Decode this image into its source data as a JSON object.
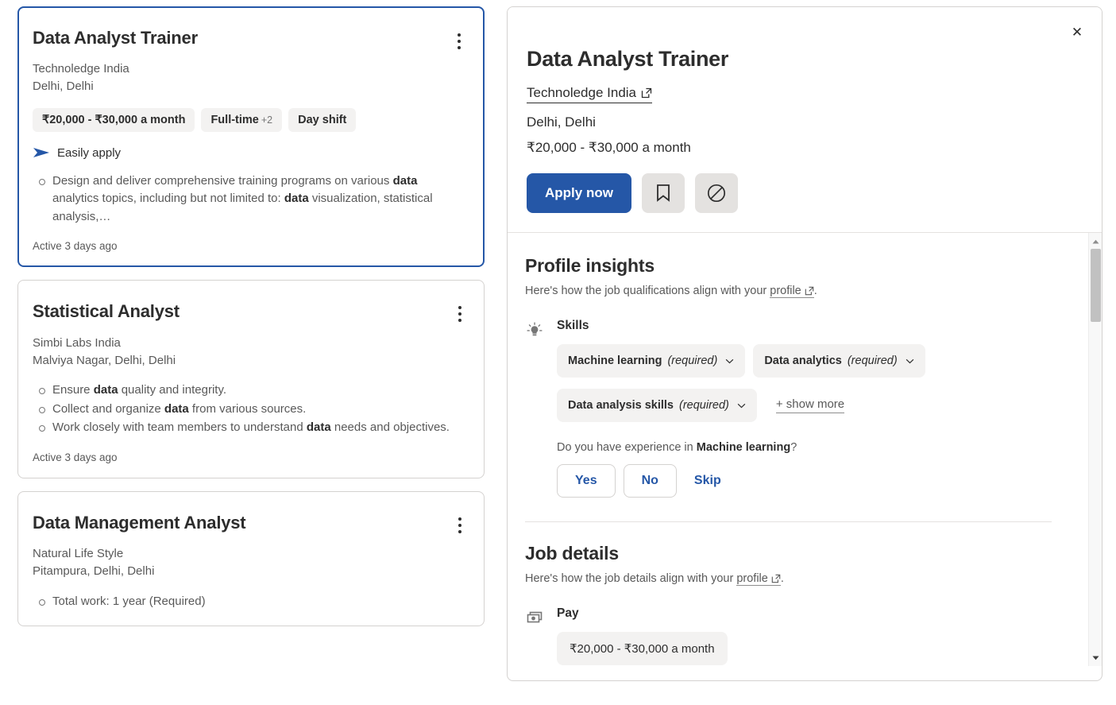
{
  "results": {
    "cards": [
      {
        "title": "Data Analyst Trainer",
        "company": "Technoledge India",
        "location": "Delhi, Delhi",
        "chips": [
          {
            "text": "₹20,000 - ₹30,000 a month",
            "extra": ""
          },
          {
            "text": "Full-time",
            "extra": "+2"
          },
          {
            "text": "Day shift",
            "extra": ""
          }
        ],
        "easily_apply": "Easily apply",
        "bullets": [
          "Design and deliver comprehensive training programs on various <b>data</b> analytics topics, including but not limited to: <b>data</b> visualization, statistical analysis,…"
        ],
        "active": "Active 3 days ago",
        "selected": true
      },
      {
        "title": "Statistical Analyst",
        "company": "Simbi Labs India",
        "location": "Malviya Nagar, Delhi, Delhi",
        "chips": [],
        "easily_apply": "",
        "bullets": [
          "Ensure <b>data</b> quality and integrity.",
          "Collect and organize <b>data</b> from various sources.",
          "Work closely with team members to understand <b>data</b> needs and objectives."
        ],
        "active": "Active 3 days ago",
        "selected": false
      },
      {
        "title": "Data Management Analyst",
        "company": "Natural Life Style",
        "location": "Pitampura, Delhi, Delhi",
        "chips": [],
        "easily_apply": "",
        "bullets": [
          "Total work: 1 year (Required)"
        ],
        "active": "",
        "selected": false
      }
    ],
    "menu_tooltip": "more options"
  },
  "detail": {
    "close_label": "✕",
    "title": "Data Analyst Trainer",
    "company": "Technoledge India",
    "location": "Delhi, Delhi",
    "pay": "₹20,000 - ₹30,000 a month",
    "apply_label": "Apply now",
    "save_icon": "bookmark-icon",
    "block_icon": "block-icon",
    "insights": {
      "heading": "Profile insights",
      "sub_prefix": "Here's how the job qualifications align with your ",
      "sub_link": "profile",
      "sub_suffix": ".",
      "skills_label": "Skills",
      "skills": [
        {
          "name": "Machine learning",
          "required": "(required)"
        },
        {
          "name": "Data analytics",
          "required": "(required)"
        },
        {
          "name": "Data analysis skills",
          "required": "(required)"
        }
      ],
      "show_more": "+ show more",
      "question_prefix": "Do you have experience in ",
      "question_skill": "Machine learning",
      "question_suffix": "?",
      "yes_label": "Yes",
      "no_label": "No",
      "skip_label": "Skip"
    },
    "job_details": {
      "heading": "Job details",
      "sub_prefix": "Here's how the job details align with your ",
      "sub_link": "profile",
      "sub_suffix": ".",
      "pay_label": "Pay",
      "pay_value": "₹20,000 - ₹30,000 a month"
    }
  },
  "colors": {
    "accent": "#2557a7",
    "chip_bg": "#f3f2f1",
    "border": "#d4d2d0",
    "text": "#2d2d2d",
    "muted": "#595959"
  }
}
